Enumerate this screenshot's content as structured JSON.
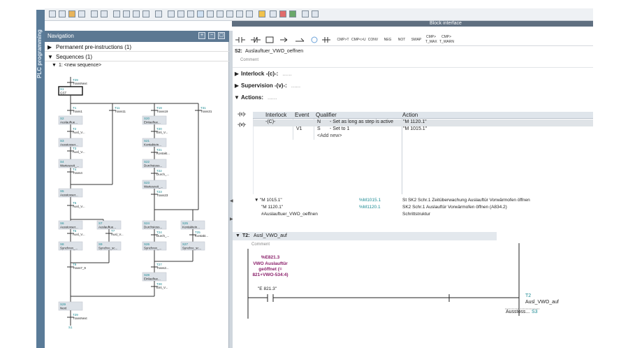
{
  "side_title": "PLC programming",
  "block_interface": "Block interface",
  "navigation": {
    "title": "Navigation",
    "rows": [
      {
        "label": "Permanent pre-instructions (1)"
      },
      {
        "label": "Sequences (1)"
      },
      {
        "label": "1: <new sequence>"
      }
    ]
  },
  "sfc": {
    "top_transition": "T29",
    "steps": [
      {
        "id": "S1",
        "name": "GST"
      },
      {
        "id": "S2",
        "name": "Auslauftue..."
      },
      {
        "id": "S3",
        "name": "Ausstosser..."
      },
      {
        "id": "S4",
        "name": "Warteszeit_..."
      },
      {
        "id": "S5",
        "name": "Ausstosser..."
      },
      {
        "id": "S6",
        "name": "Ausstosser..."
      },
      {
        "id": "S7",
        "name": "Auslauftue..."
      },
      {
        "id": "S8",
        "name": "Synchron_..."
      },
      {
        "id": "S9",
        "name": "Synchro_sc..."
      },
      {
        "id": "S29",
        "name": "Next"
      },
      {
        "id": "S20",
        "name": "Einlauftue..."
      },
      {
        "id": "S21",
        "name": "Kontaktein..."
      },
      {
        "id": "S22",
        "name": "Durchstoss..."
      },
      {
        "id": "S23",
        "name": "Warteszeit_..."
      },
      {
        "id": "S24",
        "name": "Durchstoss..."
      },
      {
        "id": "S25",
        "name": "Kontaktein..."
      },
      {
        "id": "S26",
        "name": "Synchron_..."
      },
      {
        "id": "S27",
        "name": "Synchro_sc..."
      },
      {
        "id": "S28",
        "name": "Einlauftue..."
      }
    ],
    "transitions": [
      {
        "id": "T1",
        "name": "Trans1"
      },
      {
        "id": "T2",
        "name": "Ausl_V..."
      },
      {
        "id": "T3",
        "name": "Ausl_V..."
      },
      {
        "id": "T4",
        "name": "Trans4"
      },
      {
        "id": "T5",
        "name": "Ausl_V..."
      },
      {
        "id": "T6",
        "name": "Ausl_V..."
      },
      {
        "id": "T7",
        "name": "Ausl_V..."
      },
      {
        "id": "T8",
        "name": "Ausl_V..."
      },
      {
        "id": "T9",
        "name": "Trans7_9"
      },
      {
        "id": "T29",
        "name": "TransNext"
      },
      {
        "id": "T11",
        "name": "Trans11"
      },
      {
        "id": "T19",
        "name": "Trans19"
      },
      {
        "id": "T20",
        "name": "Einl_V..."
      },
      {
        "id": "T21",
        "name": "Kontakt..."
      },
      {
        "id": "T22",
        "name": "Durch_..."
      },
      {
        "id": "T23",
        "name": "Trans23"
      },
      {
        "id": "T24",
        "name": "Durch_..."
      },
      {
        "id": "T25",
        "name": "Kontakt..."
      },
      {
        "id": "T27",
        "name": "Trans2..."
      },
      {
        "id": "T28",
        "name": "Einl_V..."
      },
      {
        "id": "T31",
        "name": "Trans31"
      }
    ],
    "end_step": "S1"
  },
  "instructions": [
    "CMP>T",
    "CMP<>U",
    "CONV",
    "NEG",
    "NOT",
    "SWAP",
    "CMP> T_MAX",
    "CMP> T_WARN"
  ],
  "step_header": {
    "id": "S2:",
    "name": "Auslauftuer_VWO_oeffnen",
    "comment": "Comment"
  },
  "sections": {
    "interlock": "Interlock -(c)-:",
    "supervision": "Supervision -(v)-:",
    "actions": "Actions:",
    "placeholder": "......"
  },
  "side_markers": [
    "-(c)-",
    "-(v)-"
  ],
  "actions_table": {
    "headers": [
      "Interlock",
      "Event",
      "Qualifier",
      "Action"
    ],
    "rows": [
      {
        "interlock": "-(C)-",
        "event": "",
        "qualifier": "N",
        "desc": "- Set as long as step is active",
        "action": "\"M 1120.1\""
      },
      {
        "interlock": "",
        "event": "V1",
        "qualifier": "S",
        "desc": "- Set to 1",
        "action": "\"M 1015.1\""
      }
    ],
    "add_new": "<Add new>"
  },
  "variables": [
    {
      "name": "\"M 1015.1\"",
      "addr": "%M1015.1",
      "comment": "St SK2 Schr.1 Zeitüberwachung Auslauftür Vorwärmofen öffnen"
    },
    {
      "name": "\"M 1120.1\"",
      "addr": "%M1120.1",
      "comment": "SK2 Schr.1 Auslauftür Vorwärmofen öffnen (A834.2)"
    },
    {
      "name": "#Auslauftuer_VWO_oeffnen",
      "addr": "",
      "comment": "Schrittstruktur"
    }
  ],
  "transition_header": {
    "id": "T2:",
    "name": "Ausl_VWO_auf",
    "comment": "Comment"
  },
  "contact": {
    "address": "%E821.3",
    "desc": "VWO Auslauftür geöffnet (= 821+VWO-534:4)",
    "tag": "\"E 821.3\""
  },
  "coil": {
    "id": "T2",
    "name": "Ausl_VWO_auf",
    "next_step_name": "Ausstoss...",
    "next_step": "S3"
  },
  "colors": {
    "accent": "#5c7892",
    "teal": "#1b8a93",
    "magenta": "#8a1f6a"
  }
}
